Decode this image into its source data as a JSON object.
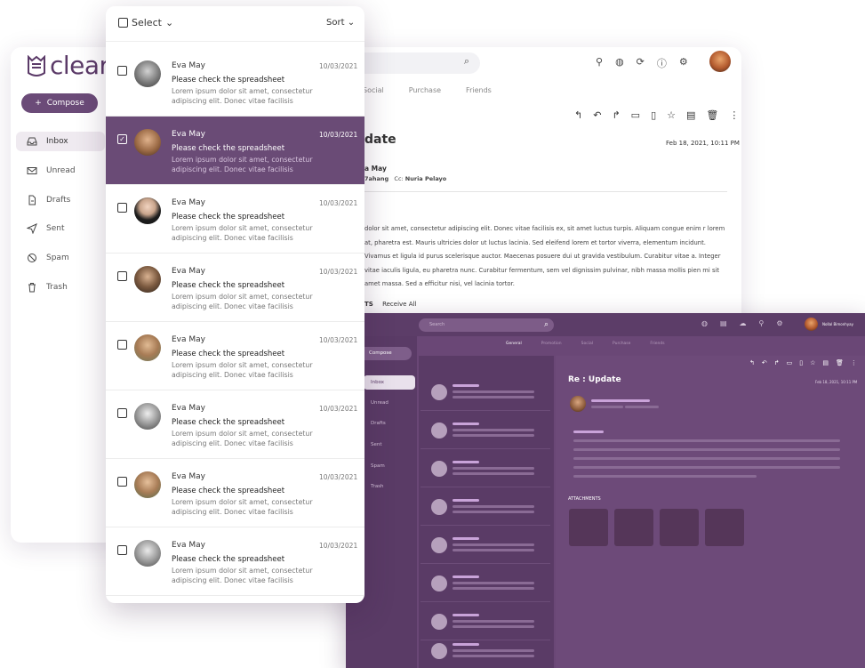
{
  "back": {
    "logo": "clear",
    "compose": "Compose",
    "nav": [
      {
        "icon": "inbox-icon",
        "label": "Inbox"
      },
      {
        "icon": "mail-icon",
        "label": "Unread"
      },
      {
        "icon": "draft-icon",
        "label": "Drafts"
      },
      {
        "icon": "send-icon",
        "label": "Sent"
      },
      {
        "icon": "ban-icon",
        "label": "Spam"
      },
      {
        "icon": "trash-icon",
        "label": "Trash"
      }
    ],
    "tabs": [
      "Social",
      "Purchase",
      "Friends"
    ],
    "subject": "date",
    "date": "Feb 18, 2021, 10:11 PM",
    "from": "a May",
    "to_name": "7ahang",
    "cc_label": "Cc:",
    "cc_name": "Nuria Pelayo",
    "body": "dolor sit amet, consectetur adipiscing elit. Donec vitae facilisis ex, sit amet luctus turpis. Aliquam congue enim r lorem at, pharetra est. Mauris ultricies dolor ut luctus lacinia. Sed eleifend lorem et tortor viverra, elementum incidunt. Vivamus et ligula id purus scelerisque auctor. Maecenas posuere dui ut gravida vestibulum. Curabitur vitae a. Integer vitae iaculis ligula, eu pharetra nunc. Curabitur fermentum, sem vel dignissim pulvinar, nibh massa mollis pien mi sit amet massa. Sed a efficitur nisi, vel lacinia tortor.",
    "attach_label": "TS",
    "receive_all": "Receive All"
  },
  "dark": {
    "search_placeholder": "Search",
    "user_name": "Nollal Bimonhyay",
    "tabs": [
      "General",
      "Promotion",
      "Social",
      "Purchase",
      "Friends"
    ],
    "compose": "Compose",
    "nav": [
      "Inbox",
      "Unread",
      "Drafts",
      "Sent",
      "Spam",
      "Trash"
    ],
    "subject": "Re : Update",
    "date": "Feb 18, 2021, 10:11 PM",
    "attachments_label": "ATTACHMENTS"
  },
  "front": {
    "select_label": "Select",
    "sort_label": "Sort",
    "emails": [
      {
        "name": "Eva May",
        "date": "10/03/2021",
        "subject": "Please check the spreadsheet",
        "preview": "Lorem ipsum dolor sit amet, consectetur adipiscing elit. Donec vitae facilisis",
        "selected": false
      },
      {
        "name": "Eva May",
        "date": "10/03/2021",
        "subject": "Please check the spreadsheet",
        "preview": "Lorem ipsum dolor sit amet, consectetur adipiscing elit. Donec vitae facilisis",
        "selected": true
      },
      {
        "name": "Eva May",
        "date": "10/03/2021",
        "subject": "Please check the spreadsheet",
        "preview": "Lorem ipsum dolor sit amet, consectetur adipiscing elit. Donec vitae facilisis",
        "selected": false
      },
      {
        "name": "Eva May",
        "date": "10/03/2021",
        "subject": "Please check the spreadsheet",
        "preview": "Lorem ipsum dolor sit amet, consectetur adipiscing elit. Donec vitae facilisis",
        "selected": false
      },
      {
        "name": "Eva May",
        "date": "10/03/2021",
        "subject": "Please check the spreadsheet",
        "preview": "Lorem ipsum dolor sit amet, consectetur adipiscing elit. Donec vitae facilisis",
        "selected": false
      },
      {
        "name": "Eva May",
        "date": "10/03/2021",
        "subject": "Please check the spreadsheet",
        "preview": "Lorem ipsum dolor sit amet, consectetur adipiscing elit. Donec vitae facilisis",
        "selected": false
      },
      {
        "name": "Eva May",
        "date": "10/03/2021",
        "subject": "Please check the spreadsheet",
        "preview": "Lorem ipsum dolor sit amet, consectetur adipiscing elit. Donec vitae facilisis",
        "selected": false
      },
      {
        "name": "Eva May",
        "date": "10/03/2021",
        "subject": "Please check the spreadsheet",
        "preview": "Lorem ipsum dolor sit amet, consectetur adipiscing elit. Donec vitae facilisis",
        "selected": false
      }
    ]
  },
  "colors": {
    "brand": "#6a4b76",
    "dark_bg": "#6a4776",
    "dark_panel": "#5a3b66",
    "accent_line": "#c9a3d9"
  }
}
